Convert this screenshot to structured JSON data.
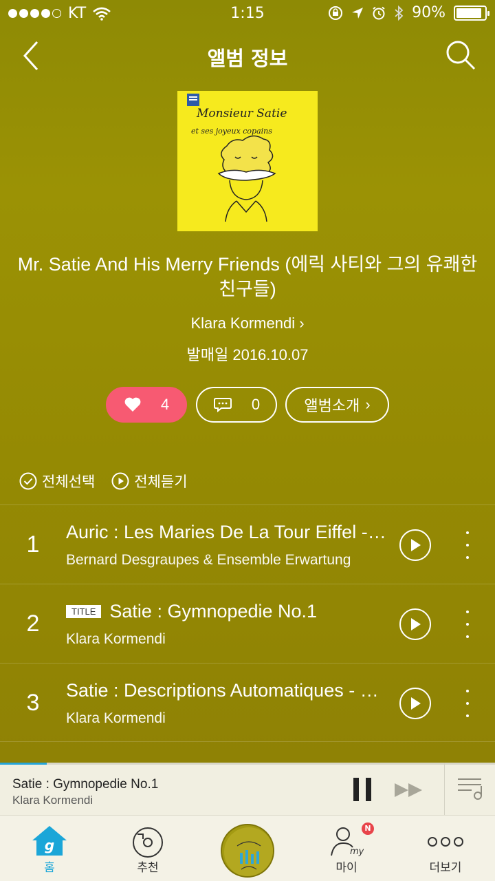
{
  "status_bar": {
    "carrier": "KT",
    "time": "1:15",
    "battery": "90%",
    "battery_level": 0.9
  },
  "header": {
    "title": "앨범 정보",
    "back_icon": "back-chevron-icon",
    "search_icon": "search-icon"
  },
  "album": {
    "cover_text_line1": "Monsieur Satie",
    "cover_text_line2": "et ses joyeux copains",
    "title": "Mr. Satie And His Merry Friends (에릭 사티와 그의 유쾌한 친구들)",
    "artist": "Klara Kormendi",
    "release_date": "발매일 2016.10.07"
  },
  "actions": {
    "like_count": "4",
    "comment_count": "0",
    "intro_label": "앨범소개",
    "colors": {
      "like_bg": "#f75a72"
    }
  },
  "list_controls": {
    "select_all": "전체선택",
    "play_all": "전체듣기"
  },
  "tracks": [
    {
      "num": "1",
      "title": "Auric : Les Maries De La Tour Eiffel - Ouverture...",
      "artist": "Bernard Desgraupes & Ensemble Erwartung",
      "badge": ""
    },
    {
      "num": "2",
      "title": "Satie : Gymnopedie No.1",
      "artist": "Klara Kormendi",
      "badge": "TITLE"
    },
    {
      "num": "3",
      "title": "Satie : Descriptions Automatiques - Sur un vaisseau",
      "artist": "Klara Kormendi",
      "badge": ""
    }
  ],
  "mini_player": {
    "title": "Satie : Gymnopedie No.1",
    "artist": "Klara Kormendi",
    "progress": 0.095,
    "progress_color": "#27a5d8"
  },
  "tab_bar": {
    "home": "홈",
    "recommend": "추천",
    "my": "마이",
    "more": "더보기",
    "my_badge": "N",
    "active_color": "#1ba6d8"
  }
}
